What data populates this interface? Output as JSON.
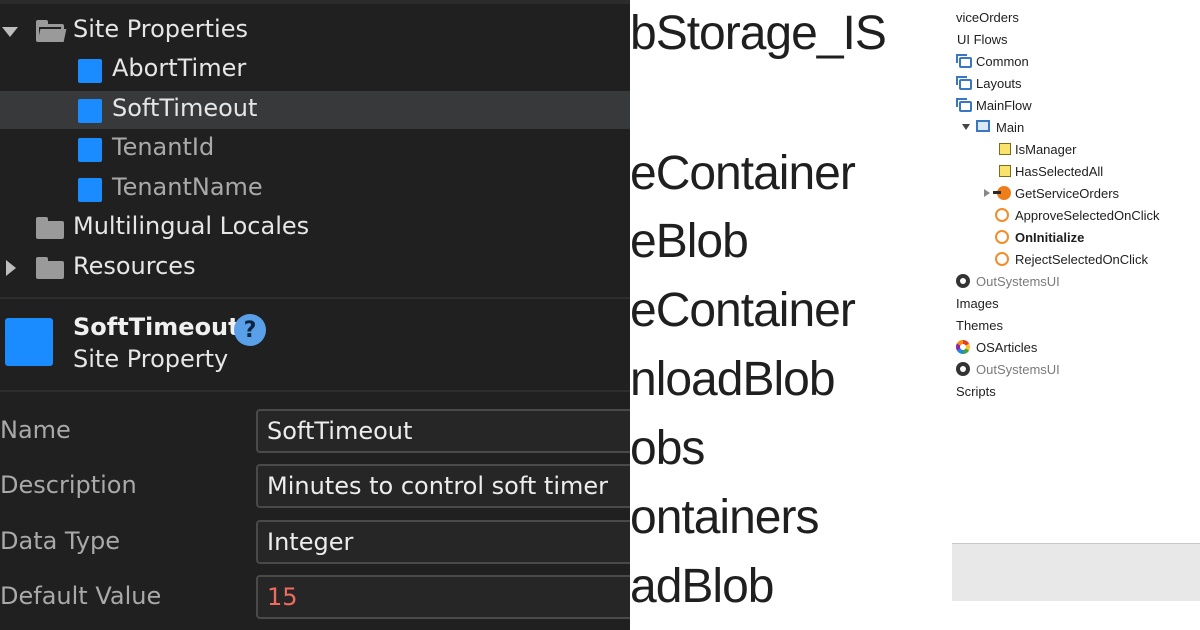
{
  "left_panel": {
    "tree": {
      "site_properties": "Site Properties",
      "abort_timer": "AbortTimer",
      "soft_timeout": "SoftTimeout",
      "tenant_id": "TenantId",
      "tenant_name": "TenantName",
      "multilingual_locales": "Multilingual Locales",
      "resources": "Resources"
    },
    "properties": {
      "title": "SoftTimeout",
      "type": "Site Property",
      "help_icon": "?",
      "fields": {
        "name_label": "Name",
        "name_value": "SoftTimeout",
        "description_label": "Description",
        "description_value": "Minutes to control soft timer",
        "data_type_label": "Data Type",
        "data_type_value": "Integer",
        "default_value_label": "Default Value",
        "default_value_value": "15"
      }
    },
    "colors": {
      "background": "#202021",
      "selected_row": "#38393b",
      "site_property_icon": "#1a8cff",
      "default_value_text": "#ee6b5e"
    }
  },
  "middle_panel": {
    "items": [
      "bStorage_IS",
      "eContainer",
      "eBlob",
      "eContainer",
      "nloadBlob",
      "obs",
      "ontainers",
      "adBlob"
    ]
  },
  "right_panel": {
    "tree": {
      "service_orders": "viceOrders",
      "ui_flows": "UI Flows",
      "common": "Common",
      "layouts": "Layouts",
      "mainflow": "MainFlow",
      "main": "Main",
      "is_manager": "IsManager",
      "has_selected_all": "HasSelectedAll",
      "get_service_orders": "GetServiceOrders",
      "approve_selected": "ApproveSelectedOnClick",
      "on_initialize": "OnInitialize",
      "reject_selected": "RejectSelectedOnClick",
      "outsystems_ui_1": "OutSystemsUI",
      "images": "Images",
      "themes": "Themes",
      "os_articles": "OSArticles",
      "outsystems_ui_2": "OutSystemsUI",
      "scripts": "Scripts"
    },
    "icons": {
      "flow": "ui-flow-icon",
      "screen": "screen-icon",
      "variable": "local-variable-icon",
      "aggregate": "aggregate-icon",
      "action": "client-action-icon",
      "module_ref": "module-reference-icon",
      "theme": "theme-icon"
    }
  }
}
